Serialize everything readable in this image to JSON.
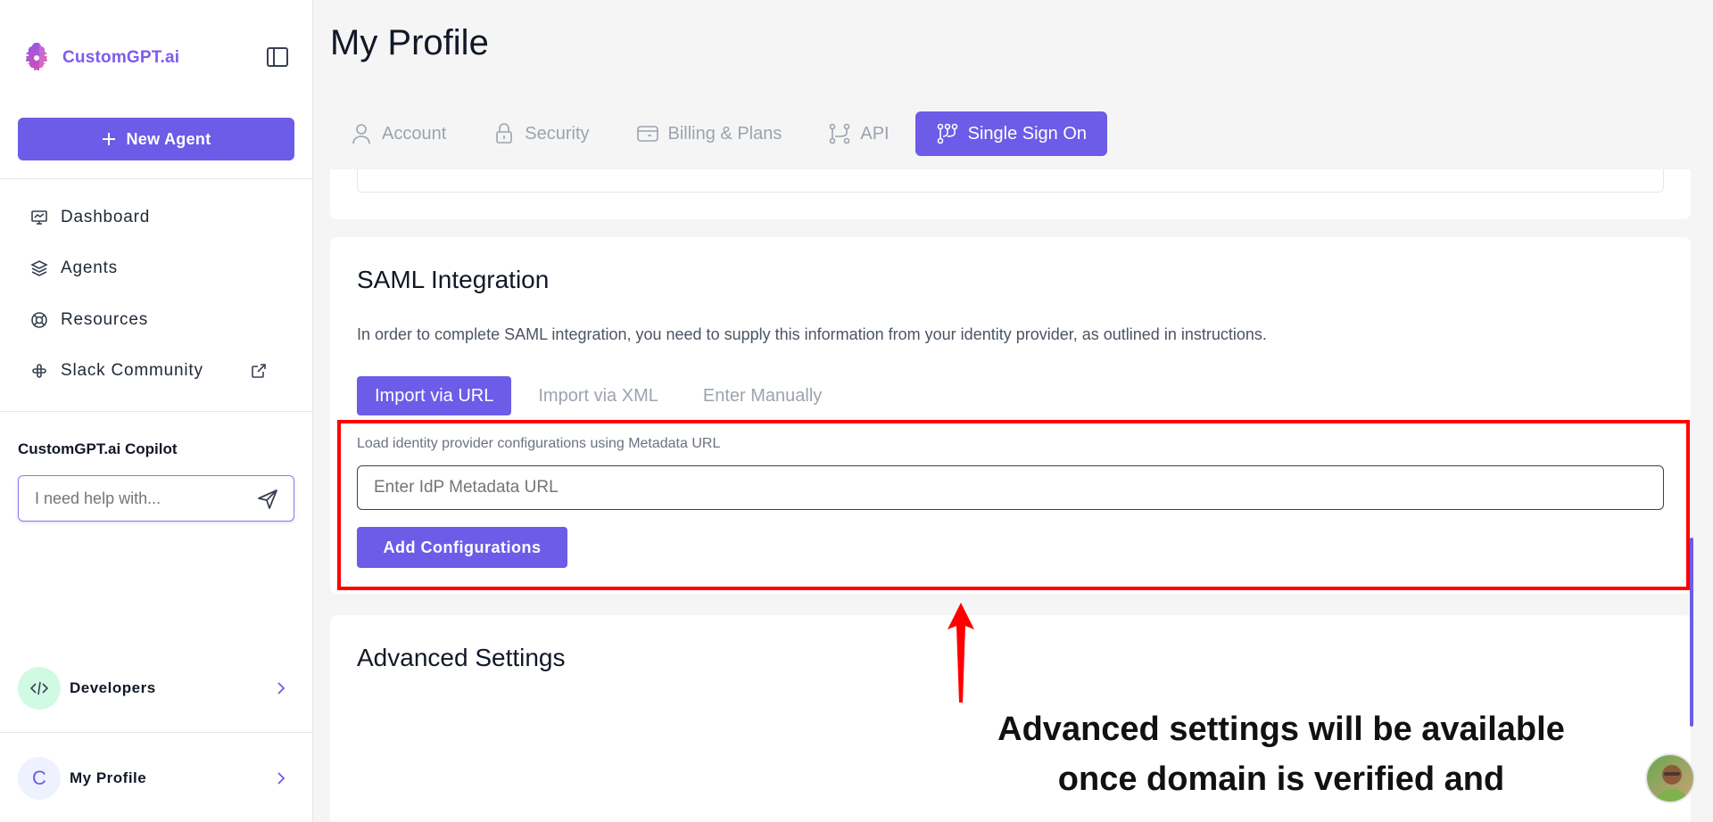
{
  "brand": {
    "name": "CustomGPT.ai"
  },
  "sidebar": {
    "new_agent_label": "New Agent",
    "nav": [
      {
        "label": "Dashboard",
        "icon": "monitor-icon"
      },
      {
        "label": "Agents",
        "icon": "layers-icon"
      },
      {
        "label": "Resources",
        "icon": "lifebuoy-icon"
      },
      {
        "label": "Slack Community",
        "icon": "slack-icon"
      }
    ],
    "copilot": {
      "title": "CustomGPT.ai Copilot",
      "placeholder": "I need help with..."
    },
    "developers_label": "Developers",
    "profile": {
      "label": "My Profile",
      "avatar_letter": "C"
    }
  },
  "page": {
    "title": "My Profile",
    "tabs": [
      {
        "label": "Account",
        "icon": "user-icon"
      },
      {
        "label": "Security",
        "icon": "lock-icon"
      },
      {
        "label": "Billing & Plans",
        "icon": "credit-card-icon"
      },
      {
        "label": "API",
        "icon": "api-icon"
      },
      {
        "label": "Single Sign On",
        "icon": "sso-icon",
        "active": true
      }
    ]
  },
  "saml": {
    "title": "SAML Integration",
    "description": "In order to complete SAML integration, you need to supply this information from your identity provider, as outlined in instructions.",
    "subtabs": [
      "Import via URL",
      "Import via XML",
      "Enter Manually"
    ],
    "active_subtab": "Import via URL",
    "url_label": "Load identity provider configurations using Metadata URL",
    "url_placeholder": "Enter IdP Metadata URL",
    "add_button": "Add Configurations"
  },
  "advanced": {
    "title": "Advanced Settings",
    "annotation_line1": "Advanced settings will be available",
    "annotation_line2": "once domain is verified and"
  },
  "colors": {
    "accent": "#6c5ce7",
    "highlight": "#ff0000",
    "logo": "#7c5cf0"
  }
}
